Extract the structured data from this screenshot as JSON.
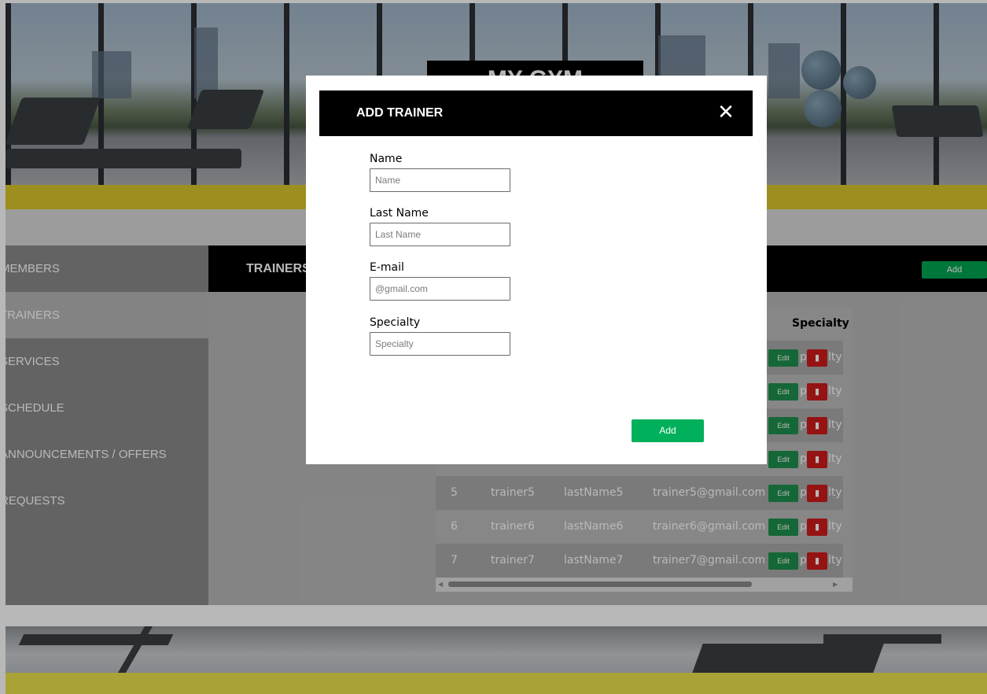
{
  "brand": {
    "logo_text": "MY GYM"
  },
  "sidebar": {
    "items": [
      {
        "label": "MEMBERS"
      },
      {
        "label": "TRAINERS"
      },
      {
        "label": "SERVICES"
      },
      {
        "label": "SCHEDULE"
      },
      {
        "label": "ANNOUNCEMENTS / OFFERS"
      },
      {
        "label": "REQUESTS"
      }
    ],
    "active_index": 1
  },
  "main": {
    "title": "TRAINERS",
    "add_label": "Add"
  },
  "table": {
    "headers": {
      "specialty": "Specialty"
    },
    "edit_label": "Edit",
    "delete_icon": "trash-icon",
    "partial_rows": [
      {
        "specialty_visible": "p",
        "specialty_tail": "lty"
      },
      {
        "specialty_visible": "p",
        "specialty_tail": "lty"
      },
      {
        "specialty_visible": "p",
        "specialty_tail": "lty"
      },
      {
        "specialty_visible": "p",
        "specialty_tail": "lty"
      }
    ],
    "rows": [
      {
        "id": "5",
        "name": "trainer5",
        "last_name": "lastName5",
        "email": "trainer5@gmail.com",
        "specialty_visible": "p",
        "specialty_tail": "lty"
      },
      {
        "id": "6",
        "name": "trainer6",
        "last_name": "lastName6",
        "email": "trainer6@gmail.com",
        "specialty_visible": "p",
        "specialty_tail": "lty"
      },
      {
        "id": "7",
        "name": "trainer7",
        "last_name": "lastName7",
        "email": "trainer7@gmail.com",
        "specialty_visible": "p",
        "specialty_tail": "lty"
      }
    ]
  },
  "modal": {
    "title": "ADD TRAINER",
    "close_icon": "close-icon",
    "fields": {
      "name": {
        "label": "Name",
        "placeholder": "Name",
        "value": ""
      },
      "last_name": {
        "label": "Last Name",
        "placeholder": "Last Name",
        "value": ""
      },
      "email": {
        "label": "E-mail",
        "placeholder": "@gmail.com",
        "value": ""
      },
      "specialty": {
        "label": "Specialty",
        "placeholder": "Specialty",
        "value": ""
      }
    },
    "submit_label": "Add"
  },
  "colors": {
    "accent_green": "#00b05b",
    "edit_green": "#1f8f4e",
    "delete_red": "#d01b1b",
    "brand_yellow": "#d9c62b"
  }
}
